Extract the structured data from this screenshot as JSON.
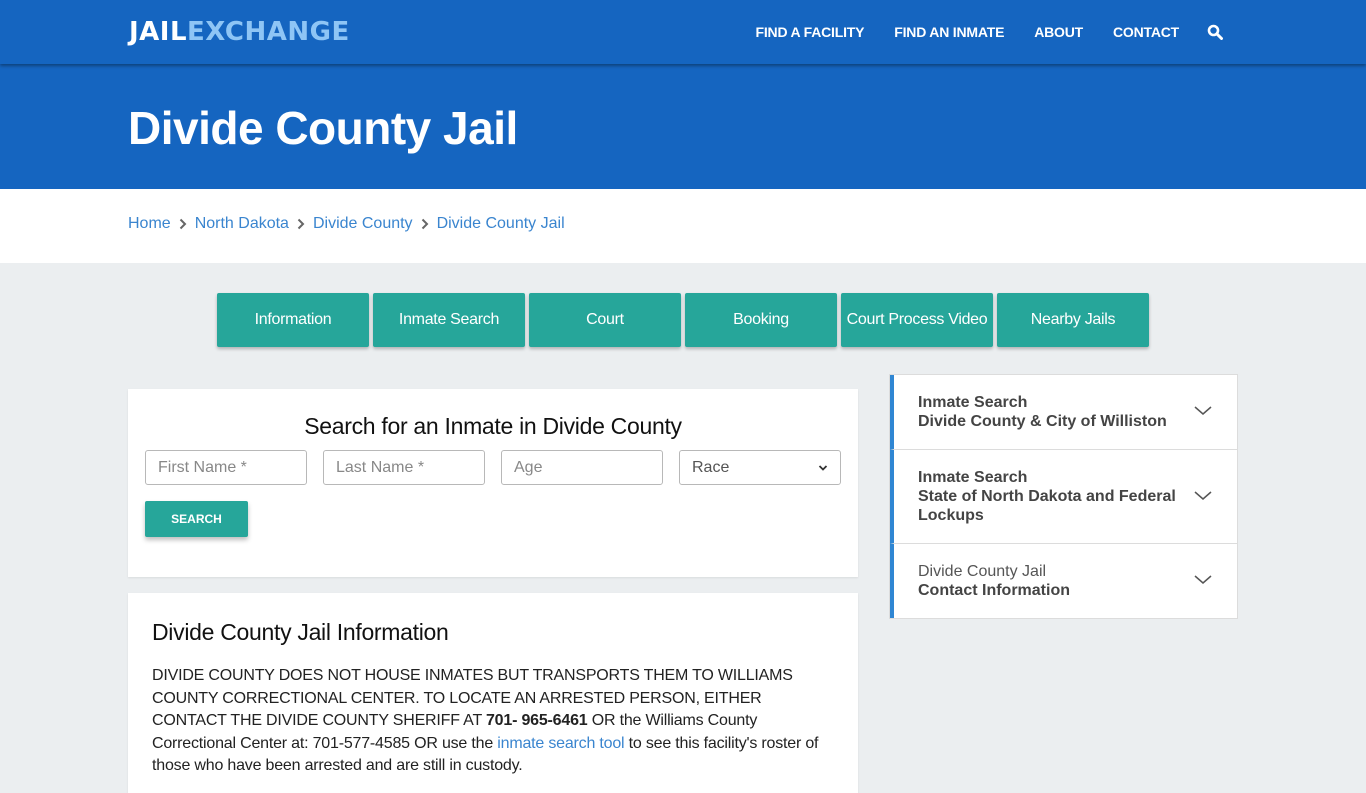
{
  "brand": {
    "part1": "JAIL",
    "part2": "EXCHANGE"
  },
  "nav": {
    "items": [
      "FIND A FACILITY",
      "FIND AN INMATE",
      "ABOUT",
      "CONTACT"
    ],
    "search_icon": "search-icon"
  },
  "hero": {
    "title": "Divide County Jail"
  },
  "breadcrumb": [
    "Home",
    "North Dakota",
    "Divide County",
    "Divide County Jail"
  ],
  "tabs": [
    "Information",
    "Inmate Search",
    "Court",
    "Booking",
    "Court Process Video",
    "Nearby Jails"
  ],
  "search": {
    "title": "Search for an Inmate in Divide County",
    "first_name_placeholder": "First Name *",
    "last_name_placeholder": "Last Name *",
    "age_placeholder": "Age",
    "race_selected": "Race",
    "button": "SEARCH"
  },
  "info": {
    "title": "Divide County Jail Information",
    "text1": "DIVIDE COUNTY DOES NOT HOUSE INMATES BUT TRANSPORTS THEM TO WILLIAMS COUNTY CORRECTIONAL CENTER.  TO LOCATE AN ARRESTED PERSON, EITHER CONTACT THE DIVIDE COUNTY SHERIFF AT ",
    "phone": "701- 965-6461",
    "text2": " OR the Williams County Correctional Center at: 701-577-4585 OR use the ",
    "link": "inmate search tool",
    "text3": " to see this facility's roster of those who have been arrested and are still in custody."
  },
  "sidebar": {
    "items": [
      {
        "line1": "Inmate Search",
        "line2": "Divide County & City of Williston"
      },
      {
        "line1": "Inmate Search",
        "line2": "State of North Dakota and Federal Lockups"
      },
      {
        "line1": "Divide County Jail",
        "line2": "Contact Information"
      }
    ]
  },
  "colors": {
    "primary": "#1565c0",
    "teal": "#26a69a",
    "link": "#3a85cf",
    "accent_border": "#2f86d3",
    "background": "#ebeef0"
  }
}
